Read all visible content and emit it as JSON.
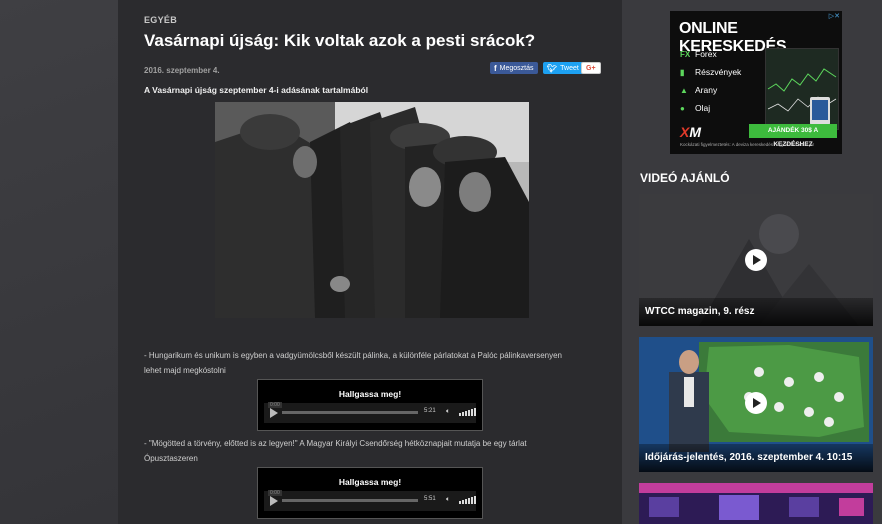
{
  "article": {
    "category": "EGYÉB",
    "title": "Vasárnapi újság: Kik voltak azok a pesti srácok?",
    "date": "2016. szeptember 4.",
    "share": {
      "facebook_label": "Megosztás",
      "twitter_label": "Tweet",
      "gplus_label": "G+"
    },
    "lead": "A Vasárnapi újság szeptember 4-i adásának tartalmából",
    "photo_icon": "black-and-white-historical-photo",
    "paragraphs": [
      "- Hungarikum és unikum is egyben a vadgyümölcsből készült pálinka, a különféle párlatokat a Palóc pálinkaversenyen lehet majd megkóstolni",
      "- \"Mögötted a törvény, előtted is az legyen!\" A Magyar Királyi Csendőrség hétköznapjait mutatja be egy tárlat Ópusztaszeren"
    ],
    "players": [
      {
        "title": "Hallgassa meg!",
        "elapsed": "0:00",
        "duration": "5:21"
      },
      {
        "title": "Hallgassa meg!",
        "elapsed": "0:00",
        "duration": "5:51"
      }
    ]
  },
  "ad": {
    "title": "ONLINE KERESKEDÉS",
    "close": "▷✕",
    "items": [
      {
        "mark": "FX",
        "label": "Forex"
      },
      {
        "mark": "▮",
        "label": "Részvények"
      },
      {
        "mark": "▲",
        "label": "Arany"
      },
      {
        "mark": "●",
        "label": "Olaj"
      }
    ],
    "logo_x": "X",
    "logo_m": "M",
    "cta": "AJÁNDÉK 30$ A KEZDÉSHEZ",
    "fine_print": "Kockázati figyelmeztetés: A deviza kereskedés nagy kockázattal jár"
  },
  "sidebar": {
    "heading": "VIDEÓ AJÁNLÓ",
    "videos": [
      {
        "caption": "WTCC magazin, 9. rész"
      },
      {
        "caption": "Időjárás-jelentés, 2016. szeptember 4. 10:15"
      },
      {
        "caption": ""
      }
    ]
  },
  "colors": {
    "page_bg": "#3a3a3e",
    "article_bg": "#2b2b2e",
    "facebook": "#3b5998",
    "twitter": "#1da1f2",
    "ad_green": "#3dbb3d",
    "xm_red": "#e23a2a"
  }
}
